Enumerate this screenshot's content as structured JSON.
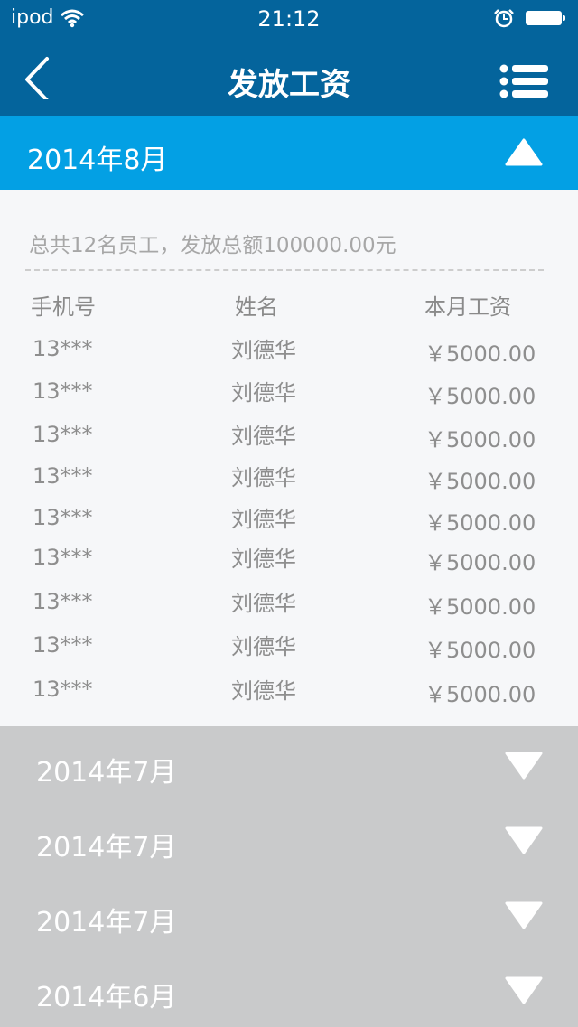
{
  "status_bar": {
    "carrier": "ipod",
    "time": "21:12"
  },
  "nav": {
    "title": "发放工资"
  },
  "open_month": {
    "label": "2014年8月",
    "summary": "总共12名员工，发放总额100000.00元",
    "columns": [
      "手机号",
      "姓名",
      "本月工资"
    ],
    "rows": [
      {
        "phone": "13***",
        "name": "刘德华",
        "salary": "￥5000.00"
      },
      {
        "phone": "13***",
        "name": "刘德华",
        "salary": "￥5000.00"
      },
      {
        "phone": "13***",
        "name": "刘德华",
        "salary": "￥5000.00"
      },
      {
        "phone": "13***",
        "name": "刘德华",
        "salary": "￥5000.00"
      },
      {
        "phone": "13***",
        "name": "刘德华",
        "salary": "￥5000.00"
      },
      {
        "phone": "13***",
        "name": "刘德华",
        "salary": "￥5000.00"
      },
      {
        "phone": "13***",
        "name": "刘德华",
        "salary": "￥5000.00"
      },
      {
        "phone": "13***",
        "name": "刘德华",
        "salary": "￥5000.00"
      },
      {
        "phone": "13***",
        "name": "刘德华",
        "salary": "￥5000.00"
      }
    ]
  },
  "collapsed_months": [
    {
      "label": "2014年7月"
    },
    {
      "label": "2014年7月"
    },
    {
      "label": "2014年7月"
    },
    {
      "label": "2014年6月"
    }
  ],
  "colors": {
    "nav_bg": "#04649c",
    "open_header_bg": "#03a0e4",
    "detail_bg": "#f6f7f9",
    "collapsed_bg": "#c9cacb"
  },
  "icons": {
    "back": "chevron-left-icon",
    "menu": "list-menu-icon",
    "expanded": "triangle-up-icon",
    "collapsed": "triangle-down-icon"
  }
}
